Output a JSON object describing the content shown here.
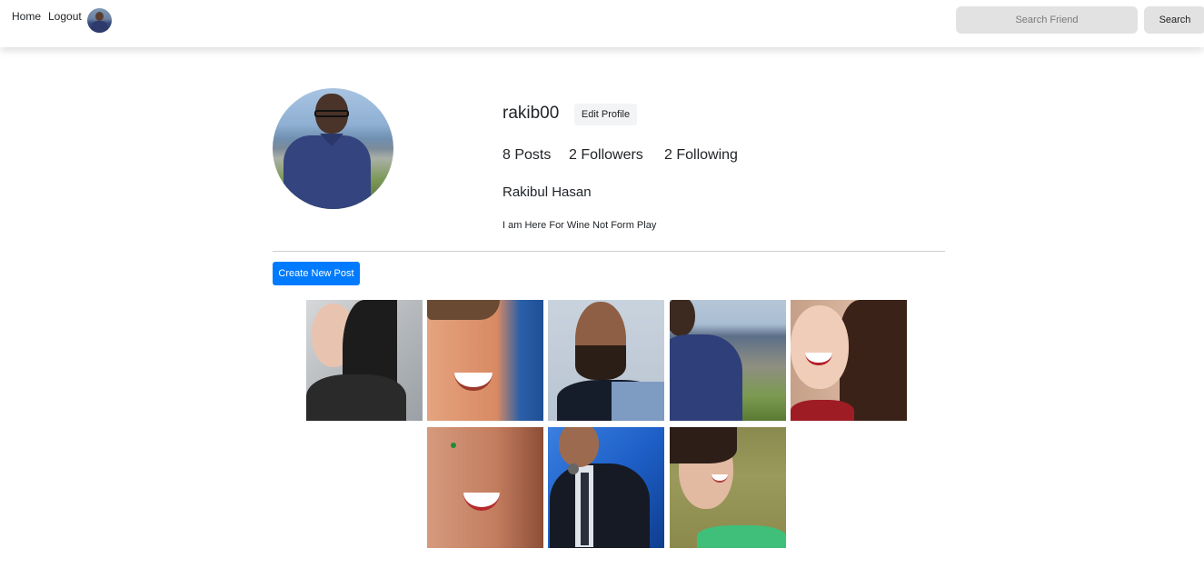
{
  "nav": {
    "home_label": "Home",
    "logout_label": "Logout"
  },
  "search": {
    "placeholder": "Search Friend",
    "button_label": "Search"
  },
  "profile": {
    "username": "rakib00",
    "edit_profile_label": "Edit Profile",
    "posts_count": "8 Posts",
    "followers_count": "2 Followers",
    "following_count": "2 Following",
    "full_name": "Rakibul Hasan",
    "bio": "I am Here For Wine Not Form Play"
  },
  "actions": {
    "create_post_label": "Create New Post"
  },
  "colors": {
    "accent": "#007bff",
    "button_gray": "#e2e2e2"
  }
}
